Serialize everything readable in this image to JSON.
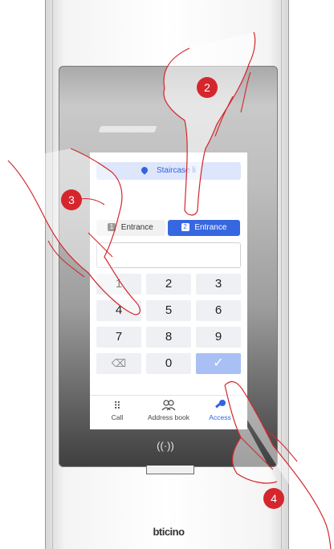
{
  "screen": {
    "banner": {
      "icon": "location-pin-icon",
      "label": "Staircase li"
    },
    "tabs": [
      {
        "number": "1",
        "label": "Entrance",
        "selected": false
      },
      {
        "number": "2",
        "label": "Entrance",
        "selected": true
      }
    ],
    "code_input": {
      "value": ""
    },
    "keypad": [
      "1",
      "2",
      "3",
      "4",
      "5",
      "6",
      "7",
      "8",
      "9",
      "⌫",
      "0",
      "✓"
    ],
    "nav": [
      {
        "label": "Call",
        "icon": "keypad-grid-icon"
      },
      {
        "label": "Address book",
        "icon": "people-icon"
      },
      {
        "label": "Access",
        "icon": "key-icon",
        "active": true
      }
    ]
  },
  "device": {
    "brand": "bticino",
    "rfid_icon": "contactless-icon"
  },
  "steps": [
    "2",
    "3",
    "4"
  ],
  "colors": {
    "accent": "#3767e0",
    "step_badge": "#d4262c",
    "hand_outline": "#d4262c"
  }
}
